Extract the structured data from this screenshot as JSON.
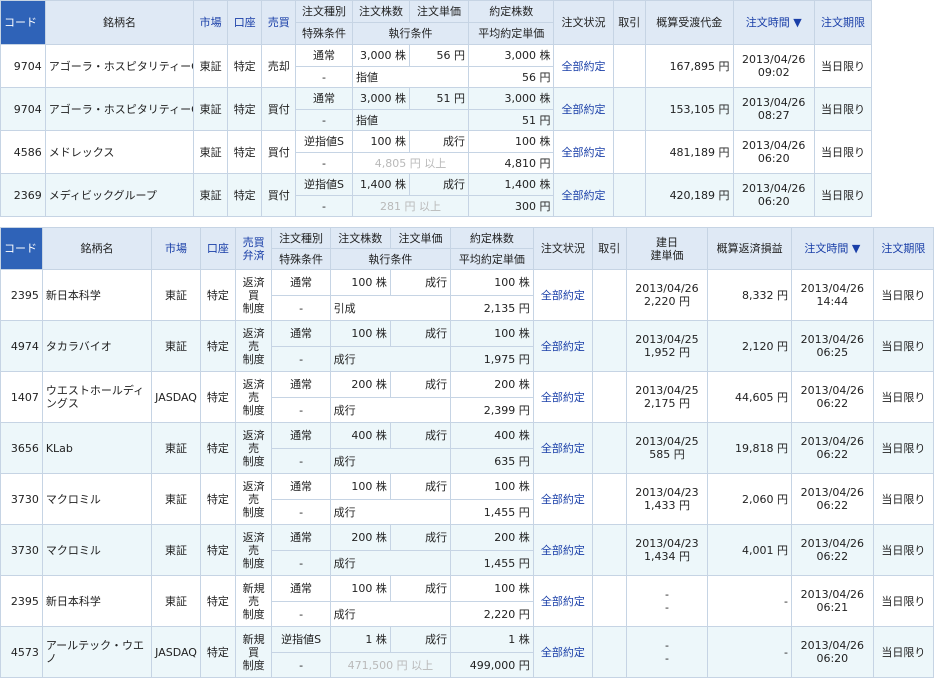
{
  "top": {
    "headers": {
      "code": "コード",
      "name": "銘柄名",
      "market": "市場",
      "account": "口座",
      "side": "売買",
      "order_type": "注文種別",
      "order_qty": "注文株数",
      "order_price": "注文単価",
      "exec_qty": "約定株数",
      "status": "注文状況",
      "torihiki": "取引",
      "amount": "概算受渡代金",
      "time": "注文時間 ▼",
      "expiry": "注文期限",
      "special": "特殊条件",
      "exec_cond": "執行条件",
      "avg_price": "平均約定単価"
    },
    "rows": [
      {
        "code": "9704",
        "name": "アゴーラ・ホスピタリティーG",
        "market": "東証",
        "account": "特定",
        "side": "売却",
        "order_type": "通常",
        "qty": "3,000 株",
        "price": "56 円",
        "exec_qty": "3,000 株",
        "special": "-",
        "cond": "指値",
        "cond_gray": "",
        "avg": "56 円",
        "status": "全部約定",
        "amount": "167,895 円",
        "date": "2013/04/26",
        "time": "09:02",
        "expiry": "当日限り"
      },
      {
        "code": "9704",
        "name": "アゴーラ・ホスピタリティーG",
        "market": "東証",
        "account": "特定",
        "side": "買付",
        "order_type": "通常",
        "qty": "3,000 株",
        "price": "51 円",
        "exec_qty": "3,000 株",
        "special": "-",
        "cond": "指値",
        "cond_gray": "",
        "avg": "51 円",
        "status": "全部約定",
        "amount": "153,105 円",
        "date": "2013/04/26",
        "time": "08:27",
        "expiry": "当日限り"
      },
      {
        "code": "4586",
        "name": "メドレックス",
        "market": "東証",
        "account": "特定",
        "side": "買付",
        "order_type": "逆指値S",
        "qty": "100 株",
        "price": "成行",
        "exec_qty": "100 株",
        "special": "-",
        "cond": "",
        "cond_gray": "4,805 円 以上",
        "avg": "4,810 円",
        "status": "全部約定",
        "amount": "481,189 円",
        "date": "2013/04/26",
        "time": "06:20",
        "expiry": "当日限り"
      },
      {
        "code": "2369",
        "name": "メディビックグループ",
        "market": "東証",
        "account": "特定",
        "side": "買付",
        "order_type": "逆指値S",
        "qty": "1,400 株",
        "price": "成行",
        "exec_qty": "1,400 株",
        "special": "-",
        "cond": "",
        "cond_gray": "281 円 以上",
        "avg": "300 円",
        "status": "全部約定",
        "amount": "420,189 円",
        "date": "2013/04/26",
        "time": "06:20",
        "expiry": "当日限り"
      }
    ]
  },
  "bottom": {
    "headers": {
      "code": "コード",
      "name": "銘柄名",
      "market": "市場",
      "account": "口座",
      "side_line1": "売買",
      "side_line2": "弁済",
      "order_type": "注文種別",
      "order_qty": "注文株数",
      "order_price": "注文単価",
      "exec_qty": "約定株数",
      "status": "注文状況",
      "torihiki": "取引",
      "build_line1": "建日",
      "build_line2": "建単価",
      "pl": "概算返済損益",
      "time": "注文時間 ▼",
      "expiry": "注文期限",
      "special": "特殊条件",
      "exec_cond": "執行条件",
      "avg_price": "平均約定単価"
    },
    "rows": [
      {
        "code": "2395",
        "name": "新日本科学",
        "market": "東証",
        "account": "特定",
        "side1": "返済",
        "side2": "買",
        "side3": "制度",
        "order_type": "通常",
        "qty": "100 株",
        "price": "成行",
        "exec_qty": "100 株",
        "special": "-",
        "cond": "引成",
        "cond_gray": "",
        "avg": "2,135 円",
        "status": "全部約定",
        "build_date": "2013/04/26",
        "build_price": "2,220 円",
        "pl": "8,332 円",
        "date": "2013/04/26",
        "time": "14:44",
        "expiry": "当日限り"
      },
      {
        "code": "4974",
        "name": "タカラバイオ",
        "market": "東証",
        "account": "特定",
        "side1": "返済",
        "side2": "売",
        "side3": "制度",
        "order_type": "通常",
        "qty": "100 株",
        "price": "成行",
        "exec_qty": "100 株",
        "special": "-",
        "cond": "成行",
        "cond_gray": "",
        "avg": "1,975 円",
        "status": "全部約定",
        "build_date": "2013/04/25",
        "build_price": "1,952 円",
        "pl": "2,120 円",
        "date": "2013/04/26",
        "time": "06:25",
        "expiry": "当日限り"
      },
      {
        "code": "1407",
        "name": "ウエストホールディングス",
        "market": "JASDAQ",
        "account": "特定",
        "side1": "返済",
        "side2": "売",
        "side3": "制度",
        "order_type": "通常",
        "qty": "200 株",
        "price": "成行",
        "exec_qty": "200 株",
        "special": "-",
        "cond": "成行",
        "cond_gray": "",
        "avg": "2,399 円",
        "status": "全部約定",
        "build_date": "2013/04/25",
        "build_price": "2,175 円",
        "pl": "44,605 円",
        "date": "2013/04/26",
        "time": "06:22",
        "expiry": "当日限り"
      },
      {
        "code": "3656",
        "name": "KLab",
        "market": "東証",
        "account": "特定",
        "side1": "返済",
        "side2": "売",
        "side3": "制度",
        "order_type": "通常",
        "qty": "400 株",
        "price": "成行",
        "exec_qty": "400 株",
        "special": "-",
        "cond": "成行",
        "cond_gray": "",
        "avg": "635 円",
        "status": "全部約定",
        "build_date": "2013/04/25",
        "build_price": "585 円",
        "pl": "19,818 円",
        "date": "2013/04/26",
        "time": "06:22",
        "expiry": "当日限り"
      },
      {
        "code": "3730",
        "name": "マクロミル",
        "market": "東証",
        "account": "特定",
        "side1": "返済",
        "side2": "売",
        "side3": "制度",
        "order_type": "通常",
        "qty": "100 株",
        "price": "成行",
        "exec_qty": "100 株",
        "special": "-",
        "cond": "成行",
        "cond_gray": "",
        "avg": "1,455 円",
        "status": "全部約定",
        "build_date": "2013/04/23",
        "build_price": "1,433 円",
        "pl": "2,060 円",
        "date": "2013/04/26",
        "time": "06:22",
        "expiry": "当日限り"
      },
      {
        "code": "3730",
        "name": "マクロミル",
        "market": "東証",
        "account": "特定",
        "side1": "返済",
        "side2": "売",
        "side3": "制度",
        "order_type": "通常",
        "qty": "200 株",
        "price": "成行",
        "exec_qty": "200 株",
        "special": "-",
        "cond": "成行",
        "cond_gray": "",
        "avg": "1,455 円",
        "status": "全部約定",
        "build_date": "2013/04/23",
        "build_price": "1,434 円",
        "pl": "4,001 円",
        "date": "2013/04/26",
        "time": "06:22",
        "expiry": "当日限り"
      },
      {
        "code": "2395",
        "name": "新日本科学",
        "market": "東証",
        "account": "特定",
        "side1": "新規",
        "side2": "売",
        "side3": "制度",
        "order_type": "通常",
        "qty": "100 株",
        "price": "成行",
        "exec_qty": "100 株",
        "special": "-",
        "cond": "成行",
        "cond_gray": "",
        "avg": "2,220 円",
        "status": "全部約定",
        "build_date": "-",
        "build_price": "-",
        "pl": "-",
        "date": "2013/04/26",
        "time": "06:21",
        "expiry": "当日限り"
      },
      {
        "code": "4573",
        "name": "アールテック・ウエノ",
        "market": "JASDAQ",
        "account": "特定",
        "side1": "新規",
        "side2": "買",
        "side3": "制度",
        "order_type": "逆指値S",
        "qty": "1 株",
        "price": "成行",
        "exec_qty": "1 株",
        "special": "-",
        "cond": "",
        "cond_gray": "471,500 円 以上",
        "avg": "499,000 円",
        "status": "全部約定",
        "build_date": "-",
        "build_price": "-",
        "pl": "-",
        "date": "2013/04/26",
        "time": "06:20",
        "expiry": "当日限り"
      }
    ]
  }
}
